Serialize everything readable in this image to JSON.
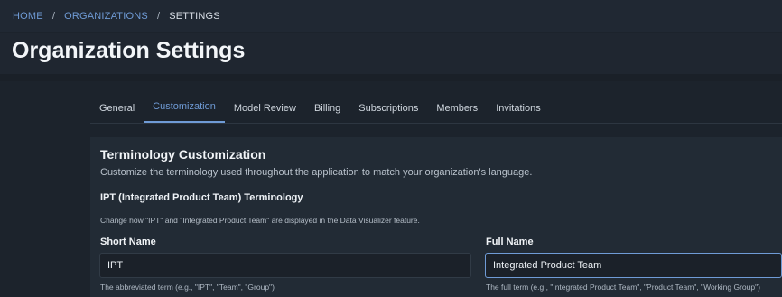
{
  "breadcrumb": {
    "home": "HOME",
    "separator": "/",
    "organizations": "ORGANIZATIONS",
    "current": "SETTINGS"
  },
  "page": {
    "title": "Organization Settings"
  },
  "tabs": [
    {
      "label": "General"
    },
    {
      "label": "Customization",
      "active": true
    },
    {
      "label": "Model Review"
    },
    {
      "label": "Billing"
    },
    {
      "label": "Subscriptions"
    },
    {
      "label": "Members"
    },
    {
      "label": "Invitations"
    }
  ],
  "card": {
    "title": "Terminology Customization",
    "description": "Customize the terminology used throughout the application to match your organization's language.",
    "section_title": "IPT (Integrated Product Team) Terminology",
    "section_description": "Change how \"IPT\" and \"Integrated Product Team\" are displayed in the Data Visualizer feature."
  },
  "fields": {
    "short_name": {
      "label": "Short Name",
      "value": "IPT",
      "help": "The abbreviated term (e.g., \"IPT\", \"Team\", \"Group\")"
    },
    "full_name": {
      "label": "Full Name",
      "value": "Integrated Product Team",
      "help": "The full term (e.g., \"Integrated Product Team\", \"Product Team\", \"Working Group\")"
    }
  },
  "colors": {
    "accent": "#6f9bd6",
    "background": "#1c232c",
    "card": "#222b35"
  }
}
